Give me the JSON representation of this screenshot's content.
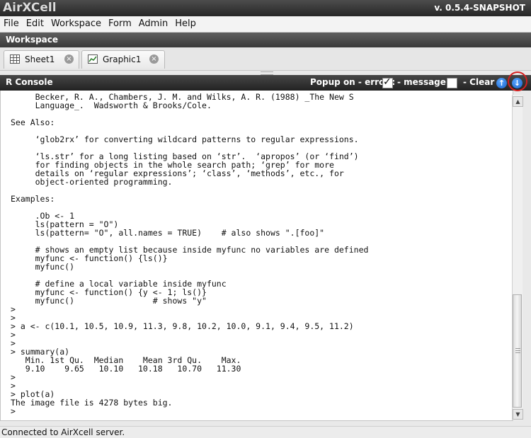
{
  "app": {
    "logo": "AirXCell",
    "version": "v. 0.5.4-SNAPSHOT"
  },
  "menu": [
    "File",
    "Edit",
    "Workspace",
    "Form",
    "Admin",
    "Help"
  ],
  "workspace": {
    "title": "Workspace"
  },
  "tabs": [
    {
      "label": "Sheet1",
      "icon": "spreadsheet-icon"
    },
    {
      "label": "Graphic1",
      "icon": "chart-icon"
    }
  ],
  "console": {
    "title": "R Console",
    "popup_label": "Popup on - error :",
    "error_checked": true,
    "message_label": "- message :",
    "message_checked": false,
    "clear_label": "- Clear",
    "scroll_up_icon": "arrow-up-icon",
    "scroll_down_icon": "arrow-down-icon",
    "output": "     Becker, R. A., Chambers, J. M. and Wilks, A. R. (1988) _The New S\n     Language_.  Wadsworth & Brooks/Cole.\n\nSee Also:\n\n     ‘glob2rx’ for converting wildcard patterns to regular expressions.\n\n     ‘ls.str’ for a long listing based on ‘str’.  ‘apropos’ (or ‘find’)\n     for finding objects in the whole search path; ‘grep’ for more\n     details on ‘regular expressions’; ‘class’, ‘methods’, etc., for\n     object-oriented programming.\n\nExamples:\n\n     .Ob <- 1\n     ls(pattern = \"O\")\n     ls(pattern= \"O\", all.names = TRUE)    # also shows \".[foo]\"\n\n     # shows an empty list because inside myfunc no variables are defined\n     myfunc <- function() {ls()}\n     myfunc()\n\n     # define a local variable inside myfunc\n     myfunc <- function() {y <- 1; ls()}\n     myfunc()                # shows \"y\"\n>\n>\n> a <- c(10.1, 10.5, 10.9, 11.3, 9.8, 10.2, 10.0, 9.1, 9.4, 9.5, 11.2)\n>\n>\n> summary(a)\n   Min. 1st Qu.  Median    Mean 3rd Qu.    Max.\n   9.10    9.65   10.10   10.18   10.70   11.30\n>\n>\n> plot(a)\nThe image file is 4278 bytes big.\n>"
  },
  "status": {
    "text": "Connected to AirXcell server."
  }
}
